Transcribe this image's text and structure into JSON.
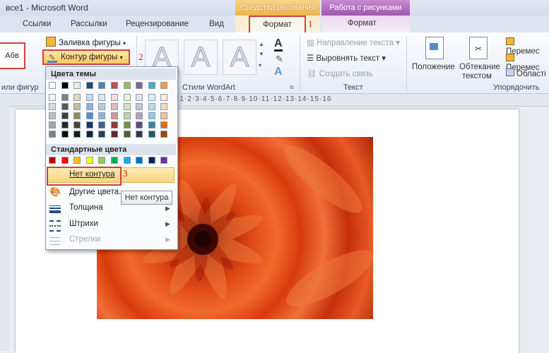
{
  "window": {
    "title": "все1 - Microsoft Word"
  },
  "context_tabs": {
    "drawing": "Средства рисования",
    "picture": "Работа с рисунками"
  },
  "tabs": [
    "Ссылки",
    "Рассылки",
    "Рецензирование",
    "Вид",
    "Формат",
    "Формат"
  ],
  "callouts": [
    "1",
    "2",
    "3"
  ],
  "ribbon": {
    "shape_styles": {
      "sample": "Абв",
      "group_label": "или фигур",
      "fill": "Заливка фигуры",
      "outline": "Контур фигуры"
    },
    "wordart": {
      "letter": "A",
      "group_label": "Стили WordArt"
    },
    "text": {
      "direction": "Направление текста",
      "align": "Выровнять текст",
      "link": "Создать связь",
      "group_label": "Текст"
    },
    "arrange": {
      "position": "Положение",
      "wrap_line1": "Обтекание",
      "wrap_line2": "текстом",
      "cut1": "Перемес",
      "cut2": "Перемес",
      "cut3": "Області",
      "group_label": "Упорядочить"
    }
  },
  "ruler": {
    "numbers": "·1·2·3·4·5·6·7·8·9·10·11·12·13·14·15·16"
  },
  "menu": {
    "theme_header": "Цвета темы",
    "standard_header": "Стандартные цвета",
    "no_outline": "Нет контура",
    "more_colors": "Другие цвета...",
    "weight": "Толщина",
    "dashes": "Штрихи",
    "arrows": "Стрелки"
  },
  "tooltip": "Нет контура",
  "theme_colors": {
    "top": [
      "#ffffff",
      "#000000",
      "#eeece1",
      "#1f497d",
      "#4f81bd",
      "#c0504d",
      "#9bbb59",
      "#8064a2",
      "#4bacc6",
      "#f79646"
    ],
    "columns": [
      [
        "#f2f2f2",
        "#d9d9d9",
        "#bfbfbf",
        "#a6a6a6",
        "#808080"
      ],
      [
        "#7f7f7f",
        "#595959",
        "#3f3f3f",
        "#262626",
        "#0d0d0d"
      ],
      [
        "#ddd9c3",
        "#c4bd97",
        "#938953",
        "#494429",
        "#1d1b10"
      ],
      [
        "#c6d9f0",
        "#8db3e2",
        "#548dd4",
        "#17365d",
        "#0f243e"
      ],
      [
        "#dbe5f1",
        "#b8cce4",
        "#95b3d7",
        "#366092",
        "#244061"
      ],
      [
        "#f2dcdb",
        "#e5b9b7",
        "#d99694",
        "#953734",
        "#632423"
      ],
      [
        "#ebf1dd",
        "#d7e3bc",
        "#c3d69b",
        "#76923c",
        "#4f6128"
      ],
      [
        "#e5e0ec",
        "#ccc1d9",
        "#b2a2c7",
        "#5f497a",
        "#3f3151"
      ],
      [
        "#dbeef3",
        "#b7dde8",
        "#92cddc",
        "#31859b",
        "#205867"
      ],
      [
        "#fdeada",
        "#fbd5b5",
        "#fac08f",
        "#e36c09",
        "#974806"
      ]
    ]
  },
  "standard_colors": [
    "#c00000",
    "#ff0000",
    "#ffc000",
    "#ffff00",
    "#92d050",
    "#00b050",
    "#00b0f0",
    "#0070c0",
    "#002060",
    "#7030a0"
  ]
}
